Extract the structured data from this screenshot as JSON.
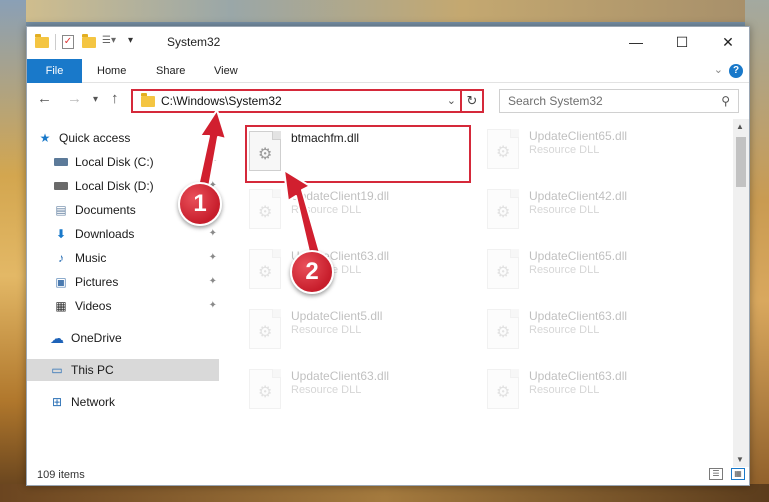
{
  "window": {
    "title": "System32",
    "controls": {
      "minimize": "—",
      "maximize": "☐",
      "close": "✕"
    }
  },
  "ribbon": {
    "tabs": [
      "File",
      "Home",
      "Share",
      "View"
    ],
    "help": "?",
    "collapse": "⌄"
  },
  "nav": {
    "address": "C:\\Windows\\System32",
    "search_placeholder": "Search System32"
  },
  "sidebar": {
    "items": [
      {
        "label": "Quick access",
        "icon": "star-icon",
        "pinned": false
      },
      {
        "label": "Local Disk (C:)",
        "icon": "drive-icon",
        "pinned": true
      },
      {
        "label": "Local Disk (D:)",
        "icon": "drive-icon",
        "pinned": true
      },
      {
        "label": "Documents",
        "icon": "documents-icon",
        "pinned": true
      },
      {
        "label": "Downloads",
        "icon": "download-icon",
        "pinned": true
      },
      {
        "label": "Music",
        "icon": "music-icon",
        "pinned": true
      },
      {
        "label": "Pictures",
        "icon": "pictures-icon",
        "pinned": true
      },
      {
        "label": "Videos",
        "icon": "videos-icon",
        "pinned": true
      },
      {
        "label": "OneDrive",
        "icon": "cloud-icon",
        "pinned": false
      },
      {
        "label": "This PC",
        "icon": "computer-icon",
        "pinned": false,
        "selected": true
      },
      {
        "label": "Network",
        "icon": "network-icon",
        "pinned": false
      }
    ]
  },
  "files": {
    "main": {
      "name": "btmachfm.dll",
      "type": ""
    },
    "others": [
      {
        "name": "UpdateClient65.dll",
        "type": "Resource DLL"
      },
      {
        "name": "UpdateClient19.dll",
        "type": "Resource DLL"
      },
      {
        "name": "UpdateClient42.dll",
        "type": "Resource DLL"
      },
      {
        "name": "UpdateClient63.dll",
        "type": "Resource DLL"
      },
      {
        "name": "UpdateClient65.dll",
        "type": "Resource DLL"
      },
      {
        "name": "UpdateClient5.dll",
        "type": "Resource DLL"
      },
      {
        "name": "UpdateClient63.dll",
        "type": "Resource DLL"
      },
      {
        "name": "UpdateClient63.dll",
        "type": "Resource DLL"
      },
      {
        "name": "UpdateClient63.dll",
        "type": "Resource DLL"
      }
    ]
  },
  "status": {
    "items": "109 items"
  },
  "callouts": {
    "one": "1",
    "two": "2"
  },
  "colors": {
    "accent": "#1979ca",
    "highlight": "#d5293a",
    "callout": "#c71d2b"
  }
}
